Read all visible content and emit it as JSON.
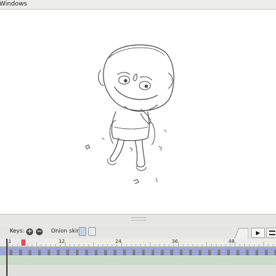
{
  "window": {
    "menu_title": "Windows"
  },
  "toolbar": {
    "keys_label": "Keys:",
    "onion_label": "Onion skin:"
  },
  "player": {
    "play_symbol": "▶"
  },
  "timeline": {
    "tick_labels": [
      "1",
      "12",
      "24",
      "36",
      "48"
    ],
    "current_frame": 4
  },
  "colors": {
    "track": "#9ea6d6",
    "key": "#7c7c80",
    "playhead": "#e05050"
  }
}
